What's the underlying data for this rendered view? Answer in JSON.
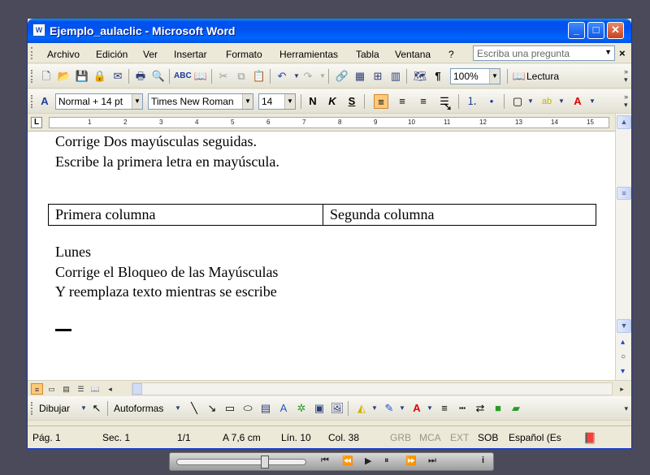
{
  "window": {
    "title": "Ejemplo_aulaclic - Microsoft Word",
    "app_icon": "W",
    "minimize": "_",
    "maximize": "□",
    "close": "✕"
  },
  "menu": {
    "items": [
      "Archivo",
      "Edición",
      "Ver",
      "Insertar",
      "Formato",
      "Herramientas",
      "Tabla",
      "Ventana",
      "?"
    ],
    "ask_placeholder": "Escriba una pregunta",
    "doc_close": "×"
  },
  "standard_toolbar": {
    "zoom": "100%",
    "lectura": "Lectura"
  },
  "format_toolbar": {
    "style": "Normal + 14 pt",
    "font": "Times New Roman",
    "size": "14",
    "bold": "N",
    "italic": "K",
    "underline": "S"
  },
  "ruler": {
    "numbers": [
      "1",
      "2",
      "3",
      "4",
      "5",
      "6",
      "7",
      "8",
      "9",
      "10",
      "11",
      "12",
      "13",
      "14",
      "15"
    ]
  },
  "document": {
    "line1": "Corrige Dos mayúsculas seguidas.",
    "line2": "Escribe la primera letra en mayúscula.",
    "table": {
      "col1": "Primera columna",
      "col2": "Segunda columna"
    },
    "line3": "Lunes",
    "line4": "Corrige el Bloqueo de las Mayúsculas",
    "line5": "Y reemplaza texto mientras se escribe"
  },
  "drawing_toolbar": {
    "dibujar": "Dibujar",
    "autoformas": "Autoformas"
  },
  "status": {
    "pag": "Pág. 1",
    "sec": "Sec. 1",
    "pages": "1/1",
    "pos": "A 7,6 cm",
    "lin": "Lín. 10",
    "col": "Col. 38",
    "grb": "GRB",
    "mca": "MCA",
    "ext": "EXT",
    "sob": "SOB",
    "lang": "Español (Es"
  }
}
